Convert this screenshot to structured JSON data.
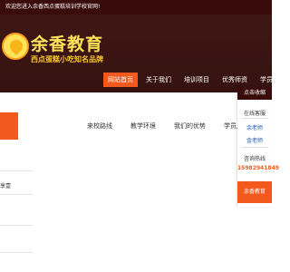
{
  "topbar": {
    "welcome": "欢迎您进入余香西点蛋糕培训学校官网!"
  },
  "brand": {
    "name": "余香教育",
    "slogan": "西点蛋糕小吃知名品牌"
  },
  "nav": {
    "items": [
      {
        "label": "网站首页",
        "active": true
      },
      {
        "label": "关于我们",
        "active": false
      },
      {
        "label": "培训项目",
        "active": false
      },
      {
        "label": "优秀师资",
        "active": false
      },
      {
        "label": "学员作品",
        "active": false
      }
    ]
  },
  "subnav": {
    "items": [
      "来校路线",
      "教学环境",
      "我们的优势",
      "学员风采"
    ]
  },
  "left": {
    "fragment": "享壹"
  },
  "sidebar": {
    "title": "点击收缩",
    "online_heading": "在线客服",
    "agents": [
      "余老师",
      "金老师"
    ],
    "hotline_heading": "咨询热线",
    "phone": "15982941849",
    "bottom": "余香教育"
  },
  "colors": {
    "accent": "#f25a1d",
    "header_bg": "#3e1714",
    "brand_yellow": "#ffe45a"
  }
}
